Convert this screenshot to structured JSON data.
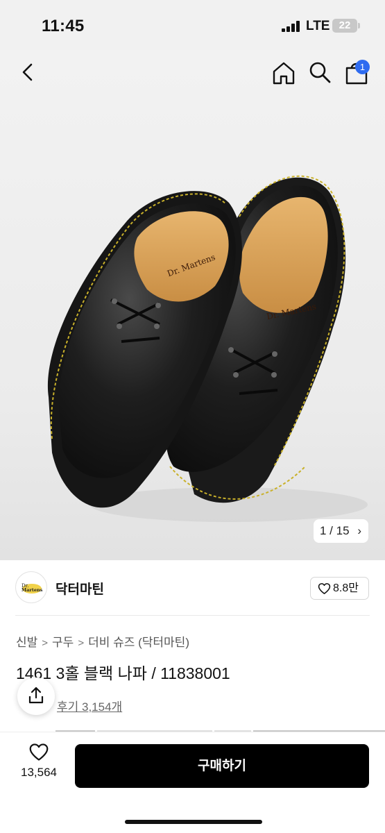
{
  "status_bar": {
    "time": "11:45",
    "network": "LTE",
    "battery": "22"
  },
  "header": {
    "back_icon": "chevron-left-icon",
    "home_icon": "home-icon",
    "search_icon": "search-icon",
    "cart_icon": "shopping-bag-icon",
    "cart_badge": "1",
    "badge_color": "#2e6bf0"
  },
  "gallery": {
    "counter": "1 / 15",
    "counter_chevron": "›",
    "current": 1,
    "total": 15
  },
  "brand": {
    "logo_text": "Dr. Martens",
    "name": "닥터마틴",
    "likes": "8.8만"
  },
  "breadcrumb": [
    "신발",
    "구두",
    "더비 슈즈 (닥터마틴)"
  ],
  "product": {
    "title": "1461 3홀 블랙 나파 / 11838001",
    "review_link": "후기 3,154개"
  },
  "bottom_bar": {
    "wish_count": "13,564",
    "buy_label": "구매하기",
    "buy_color": "#000000"
  }
}
